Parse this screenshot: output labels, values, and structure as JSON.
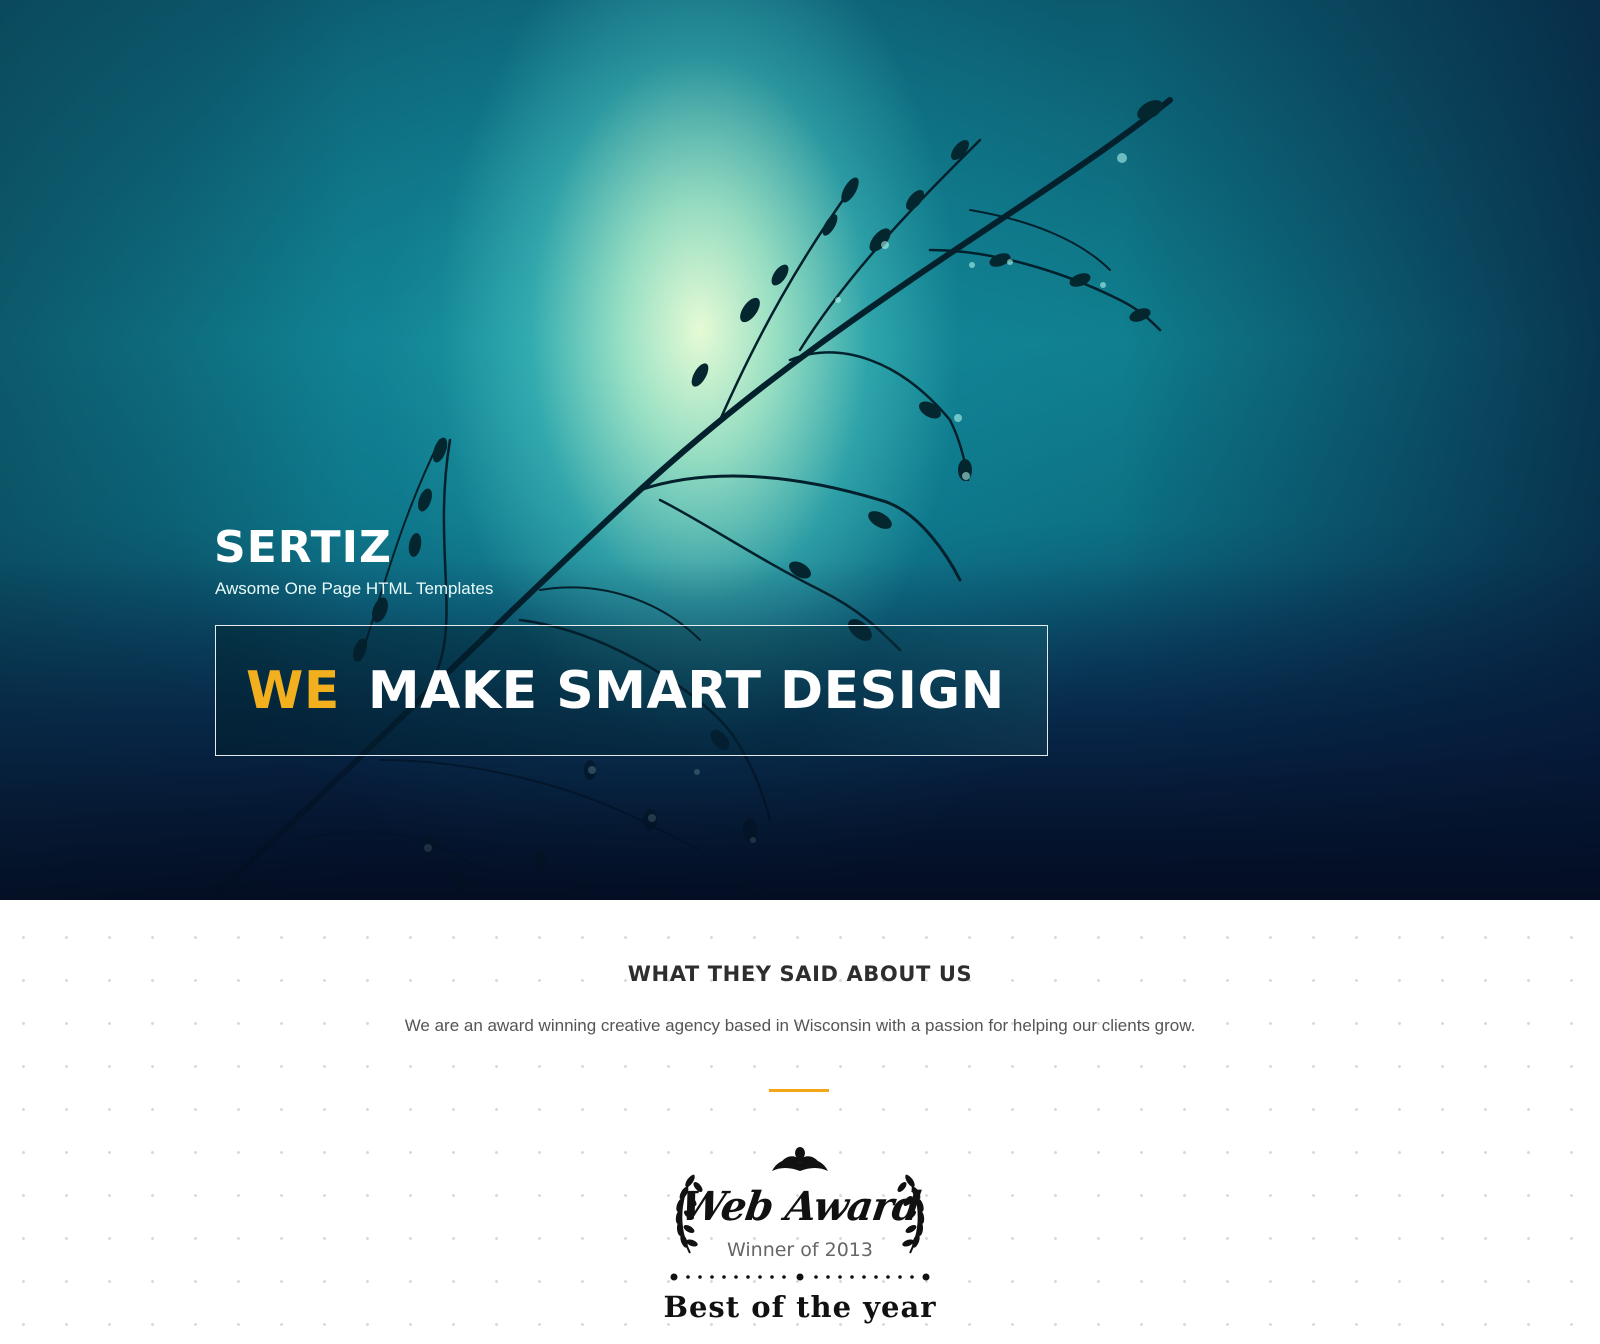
{
  "hero": {
    "brand": "SERTIZ",
    "tagline": "Awsome One Page HTML Templates",
    "headline_accent": "WE",
    "headline_rest": "MAKE SMART DESIGN",
    "accent_color": "#f2b01e"
  },
  "testimonials": {
    "title": "WHAT THEY SAID ABOUT US",
    "text": "We are an award winning creative agency based in Wisconsin with a passion for helping our clients grow.",
    "divider_color": "#f2a516"
  },
  "award": {
    "title": "Web Award",
    "subtitle": "Winner of 2013",
    "tagline": "Best of the year"
  }
}
